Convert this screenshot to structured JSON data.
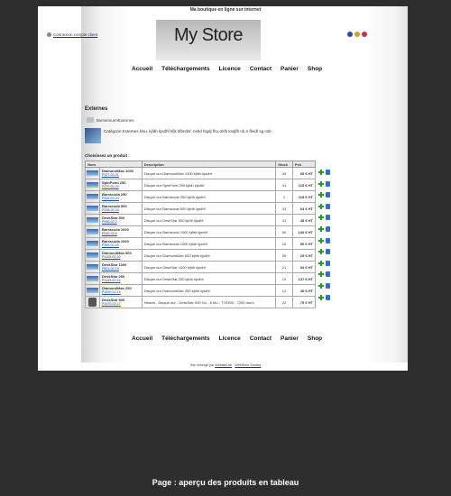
{
  "header": {
    "tagline": "Ma boutique en ligne sur internet",
    "login_link": "Connexion compte client",
    "logo_text": "My Store",
    "flags": [
      {
        "name": "uk-flag-icon",
        "color": "#2b4fa3"
      },
      {
        "name": "es-flag-icon",
        "color": "#d8a01a"
      },
      {
        "name": "fr-flag-icon",
        "color": "#c8323c"
      }
    ]
  },
  "nav": {
    "items": [
      "Accueil",
      "Téléchargements",
      "Licence",
      "Contact",
      "Panier",
      "Shop"
    ]
  },
  "section": {
    "title": "Externes",
    "breadcrumb": "Bienvenue>Externes",
    "category_description": "Catégorie Externes klsu, kjfdh kjsdhf kfjk kfbndsf, nsbd fsgdj fhu,dnfb ksdjfh nb,n fbsdf sg nsb",
    "choose_label": "Choisissez un produit :"
  },
  "table": {
    "headers": [
      "Nom",
      "Description",
      "Stock",
      "Prix"
    ],
    "rows": [
      {
        "name": "DiamondMax 1000",
        "ref": "P327-02-21",
        "desc": "Disque dur DiamondMax 1000 kjfdh kjsdhf",
        "stock": "39",
        "price": "65 € HT",
        "thumb": "disk"
      },
      {
        "name": "SpinPoint 250",
        "ref": "P470-02-22",
        "desc": "Disque dur SpinPoint 250 kjfdh kjsdhf",
        "stock": "41",
        "price": "115 € HT",
        "thumb": "disk"
      },
      {
        "name": "Barracuda 250",
        "ref": "P345-02-23",
        "desc": "Disque dur Barracuda 250 kjfdh kjsdhf",
        "stock": "1",
        "price": "118 € HT",
        "thumb": "disk"
      },
      {
        "name": "Barracuda 500",
        "ref": "P238-02-24",
        "desc": "Disque dur Barracuda 500 kjfdh kjsdhf",
        "stock": "43",
        "price": "64 € HT",
        "thumb": "disk"
      },
      {
        "name": "DeskStar 500",
        "ref": "P496-02-2",
        "desc": "Disque dur DeskStar 500 kjfdh kjsdhf",
        "stock": "41",
        "price": "48 € HT",
        "thumb": "disk"
      },
      {
        "name": "Barracuda 1000",
        "ref": "P240-02-6",
        "desc": "Disque dur Barracuda 1000 kjfdh kjsdhf",
        "stock": "50",
        "price": "140 € HT",
        "thumb": "disk"
      },
      {
        "name": "Barracuda 1000",
        "ref": "P269-02-25",
        "desc": "Disque dur Barracuda 1000 kjfdh kjsdhf",
        "stock": "15",
        "price": "50 € HT",
        "thumb": "disk"
      },
      {
        "name": "DiamondMax 500",
        "ref": "P1105-02-20",
        "desc": "Disque dur DiamondMax 500 kjfdh kjsdhf",
        "stock": "39",
        "price": "29 € HT",
        "thumb": "disk"
      },
      {
        "name": "DeskStar 1000",
        "ref": "P801-02-19",
        "desc": "Disque dur DeskStar 1000 kjfdh kjsdhf",
        "stock": "21",
        "price": "54 € HT",
        "thumb": "disk"
      },
      {
        "name": "DeskStar 250",
        "ref": "P1149-02-15",
        "desc": "Disque dur DeskStar 250 kjfdh kjsdhf",
        "stock": "19",
        "price": "137 € HT",
        "thumb": "disk"
      },
      {
        "name": "DiamondMax 250",
        "ref": "P1490-02-16",
        "desc": "Disque dur DiamondMax 250 kjfdh kjsdhf",
        "stock": "12",
        "price": "40 € HT",
        "thumb": "disk"
      },
      {
        "name": "DeskStar 500",
        "ref": "P1470-02-17",
        "desc": "Hitachi - Disque dur - DeskStar 500 Go - 8 Mo - T7K500 - 7200 tours",
        "stock": "22",
        "price": "79 € HT",
        "thumb": "drive"
      }
    ]
  },
  "footer": {
    "prefix": "Site hébergé par",
    "link1": "WebsiteLab",
    "separator": "-",
    "link2": "WebStore Studios"
  },
  "caption": "Page : aperçu des produits en tableau"
}
